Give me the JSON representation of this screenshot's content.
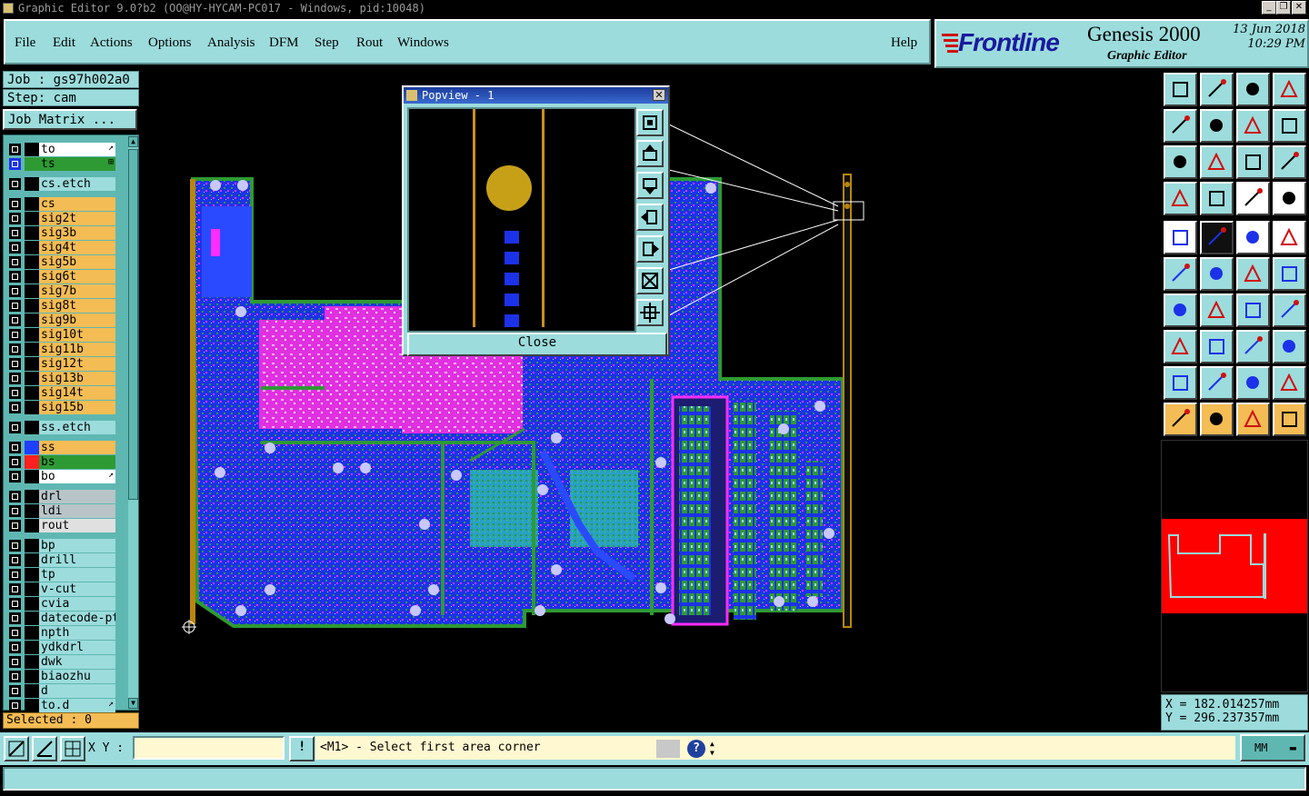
{
  "window": {
    "title": "Graphic Editor 9.0?b2 (OO@HY-HYCAM-PC017 - Windows, pid:10048)",
    "min": "_",
    "max": "❐",
    "close": "✕"
  },
  "menu": [
    "File",
    "Edit",
    "Actions",
    "Options",
    "Analysis",
    "DFM",
    "Step",
    "Rout",
    "Windows"
  ],
  "help": "Help",
  "logo": {
    "brand": "Frontline",
    "product": "Genesis 2000",
    "subtitle": "Graphic Editor",
    "date": "13 Jun 2018",
    "time": "10:29 PM"
  },
  "job": "Job : gs97h002a0",
  "step": "Step: cam",
  "job_matrix": "Job Matrix ...",
  "layers": [
    {
      "name": "to",
      "bg": "#ffffff",
      "swatch": "#000000",
      "mark": "↗",
      "selected": false
    },
    {
      "name": "ts",
      "bg": "#2e9a34",
      "swatch": "#2e9a34",
      "mark": "⊞",
      "selected": true
    },
    {
      "name": "cs.etch",
      "bg": "#9cdcdc",
      "swatch": "#000000",
      "mark": "",
      "selected": false
    },
    {
      "name": "cs",
      "bg": "#f4bc54",
      "swatch": "#000000",
      "mark": "",
      "selected": false
    },
    {
      "name": "sig2t",
      "bg": "#f4bc54",
      "swatch": "#000000",
      "mark": "",
      "selected": false
    },
    {
      "name": "sig3b",
      "bg": "#f4bc54",
      "swatch": "#000000",
      "mark": "",
      "selected": false
    },
    {
      "name": "sig4t",
      "bg": "#f4bc54",
      "swatch": "#000000",
      "mark": "",
      "selected": false
    },
    {
      "name": "sig5b",
      "bg": "#f4bc54",
      "swatch": "#000000",
      "mark": "",
      "selected": false
    },
    {
      "name": "sig6t",
      "bg": "#f4bc54",
      "swatch": "#000000",
      "mark": "",
      "selected": false
    },
    {
      "name": "sig7b",
      "bg": "#f4bc54",
      "swatch": "#000000",
      "mark": "",
      "selected": false
    },
    {
      "name": "sig8t",
      "bg": "#f4bc54",
      "swatch": "#000000",
      "mark": "",
      "selected": false
    },
    {
      "name": "sig9b",
      "bg": "#f4bc54",
      "swatch": "#000000",
      "mark": "",
      "selected": false
    },
    {
      "name": "sig10t",
      "bg": "#f4bc54",
      "swatch": "#000000",
      "mark": "",
      "selected": false
    },
    {
      "name": "sig11b",
      "bg": "#f4bc54",
      "swatch": "#000000",
      "mark": "",
      "selected": false
    },
    {
      "name": "sig12t",
      "bg": "#f4bc54",
      "swatch": "#000000",
      "mark": "",
      "selected": false
    },
    {
      "name": "sig13b",
      "bg": "#f4bc54",
      "swatch": "#000000",
      "mark": "",
      "selected": false
    },
    {
      "name": "sig14t",
      "bg": "#f4bc54",
      "swatch": "#000000",
      "mark": "",
      "selected": false
    },
    {
      "name": "sig15b",
      "bg": "#f4bc54",
      "swatch": "#000000",
      "mark": "",
      "selected": false
    },
    {
      "name": "ss.etch",
      "bg": "#9cdcdc",
      "swatch": "#000000",
      "mark": "",
      "selected": false
    },
    {
      "name": "ss",
      "bg": "#f4bc54",
      "swatch": "#1f3fff",
      "mark": "",
      "selected": false
    },
    {
      "name": "bs",
      "bg": "#2e9a34",
      "swatch": "#ff2020",
      "mark": "",
      "selected": false
    },
    {
      "name": "bo",
      "bg": "#ffffff",
      "swatch": "#000000",
      "mark": "↗",
      "selected": false
    },
    {
      "name": "drl",
      "bg": "#b8c4c8",
      "swatch": "#000000",
      "mark": "",
      "selected": false
    },
    {
      "name": "ldi",
      "bg": "#b8c4c8",
      "swatch": "#000000",
      "mark": "",
      "selected": false
    },
    {
      "name": "rout",
      "bg": "#e0e0e0",
      "swatch": "#000000",
      "mark": "",
      "selected": false
    },
    {
      "name": "bp",
      "bg": "#9cdcdc",
      "swatch": "#000000",
      "mark": "",
      "selected": false
    },
    {
      "name": "drill",
      "bg": "#9cdcdc",
      "swatch": "#000000",
      "mark": "",
      "selected": false
    },
    {
      "name": "tp",
      "bg": "#9cdcdc",
      "swatch": "#000000",
      "mark": "",
      "selected": false
    },
    {
      "name": "v-cut",
      "bg": "#9cdcdc",
      "swatch": "#000000",
      "mark": "",
      "selected": false
    },
    {
      "name": "cvia",
      "bg": "#9cdcdc",
      "swatch": "#000000",
      "mark": "",
      "selected": false
    },
    {
      "name": "datecode-pt",
      "bg": "#9cdcdc",
      "swatch": "#000000",
      "mark": "",
      "selected": false
    },
    {
      "name": "npth",
      "bg": "#9cdcdc",
      "swatch": "#000000",
      "mark": "",
      "selected": false
    },
    {
      "name": "ydkdrl",
      "bg": "#9cdcdc",
      "swatch": "#000000",
      "mark": "",
      "selected": false
    },
    {
      "name": "dwk",
      "bg": "#9cdcdc",
      "swatch": "#000000",
      "mark": "",
      "selected": false
    },
    {
      "name": "biaozhu",
      "bg": "#9cdcdc",
      "swatch": "#000000",
      "mark": "",
      "selected": false
    },
    {
      "name": "d",
      "bg": "#9cdcdc",
      "swatch": "#000000",
      "mark": "",
      "selected": false
    },
    {
      "name": "to.d",
      "bg": "#9cdcdc",
      "swatch": "#000000",
      "mark": "↗",
      "selected": false
    }
  ],
  "selected": "Selected : 0",
  "popview": {
    "title": "Popview - 1",
    "close_label": "Close"
  },
  "coords": {
    "x": "X  = 182.014257mm",
    "y": "Y  = 296.237357mm"
  },
  "status": {
    "xy_label": "X Y :",
    "xy_value": "",
    "info_icon": "!",
    "message": "<M1> - Select first area corner",
    "units": "MM"
  },
  "colors": {
    "panel": "#9cdcdc",
    "signal_layer": "#f4bc54",
    "board_blue": "#1c32e8",
    "board_green": "#2e9a34",
    "board_magenta": "#ff2cff",
    "overview_red": "#ff0000"
  }
}
